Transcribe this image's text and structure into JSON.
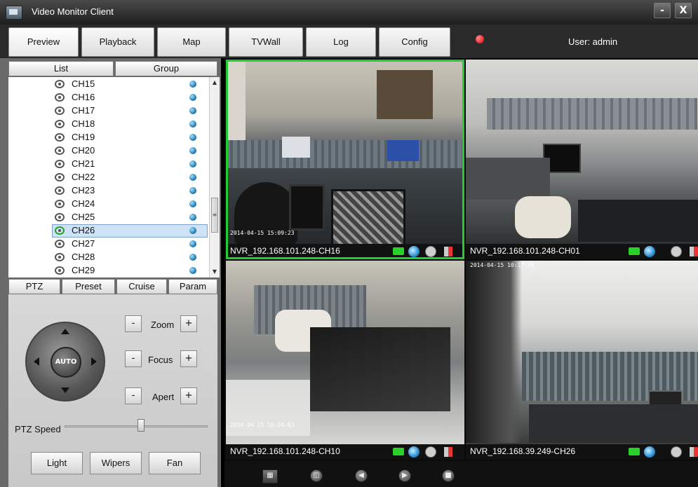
{
  "window": {
    "title": "Video Monitor Client",
    "minimize": "-",
    "close": "X"
  },
  "nav": [
    "Preview",
    "Playback",
    "Map",
    "TVWall",
    "Log",
    "Config"
  ],
  "user": {
    "label": "User: admin"
  },
  "list_tabs": [
    "List",
    "Group"
  ],
  "channels": [
    "CH15",
    "CH16",
    "CH17",
    "CH18",
    "CH19",
    "CH20",
    "CH21",
    "CH22",
    "CH23",
    "CH24",
    "CH25",
    "CH26",
    "CH27",
    "CH28",
    "CH29"
  ],
  "selected_channel": "CH26",
  "ptz_tabs": [
    "PTZ",
    "Preset",
    "Cruise",
    "Param"
  ],
  "ptz": {
    "auto": "AUTO",
    "zoom": "Zoom",
    "focus": "Focus",
    "apert": "Apert",
    "minus": "-",
    "plus": "+",
    "speed_label": "PTZ Speed",
    "speed_level": 0.5
  },
  "aux_buttons": [
    "Light",
    "Wipers",
    "Fan"
  ],
  "video_tiles": [
    {
      "name": "NVR_192.168.101.248-CH16",
      "timestamp": "2014-04-15 15:09:23",
      "selected": true
    },
    {
      "name": "NVR_192.168.101.248-CH01",
      "timestamp": "",
      "selected": false
    },
    {
      "name": "NVR_192.168.101.248-CH10",
      "timestamp": "2014 04 15 16:34:03",
      "selected": false
    },
    {
      "name": "NVR_192.168.39.249-CH26",
      "timestamp": "2014-04-15 10:17:50",
      "selected": false
    }
  ],
  "colors": {
    "selected_frame": "#22cc33",
    "status_dot": "#1b6ea6"
  }
}
